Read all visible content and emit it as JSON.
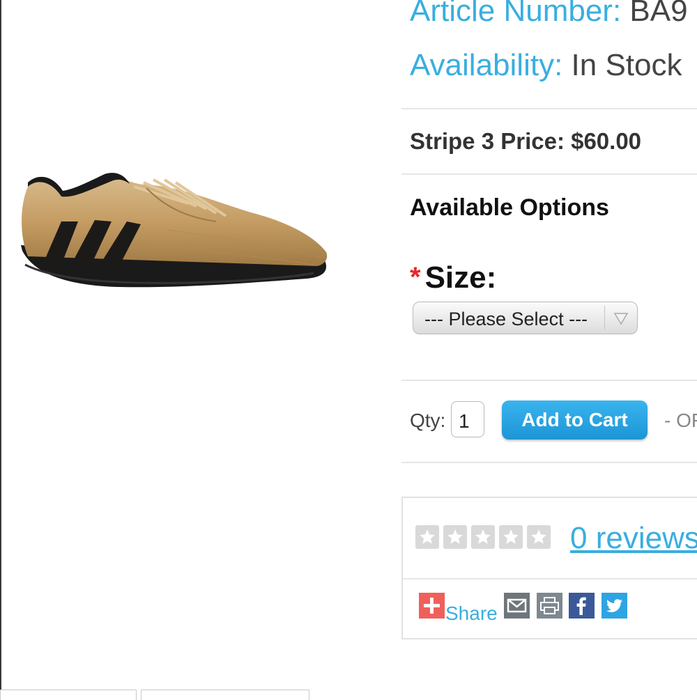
{
  "product": {
    "article_label": "Article Number:",
    "article_value": "BA9",
    "availability_label": "Availability:",
    "availability_value": "In Stock",
    "price_text": "Stripe 3 Price: $60.00",
    "options_title": "Available Options",
    "required_mark": "*",
    "size_label": "Size:",
    "size_select_value": "--- Please Select ---",
    "qty_label": "Qty:",
    "qty_value": "1",
    "add_to_cart_label": "Add to Cart",
    "or_text": "- OF"
  },
  "reviews": {
    "rating": 0,
    "rating_max": 5,
    "link_text": "0 reviews"
  },
  "share": {
    "label": "Share",
    "icons": [
      "email-icon",
      "print-icon",
      "facebook-icon",
      "twitter-icon"
    ]
  },
  "colors": {
    "accent_blue": "#39aee0",
    "button_blue": "#1c95d6",
    "required_red": "#e8262a",
    "share_plus": "#f0605a",
    "facebook": "#3b5998",
    "twitter": "#2fa4e3"
  }
}
